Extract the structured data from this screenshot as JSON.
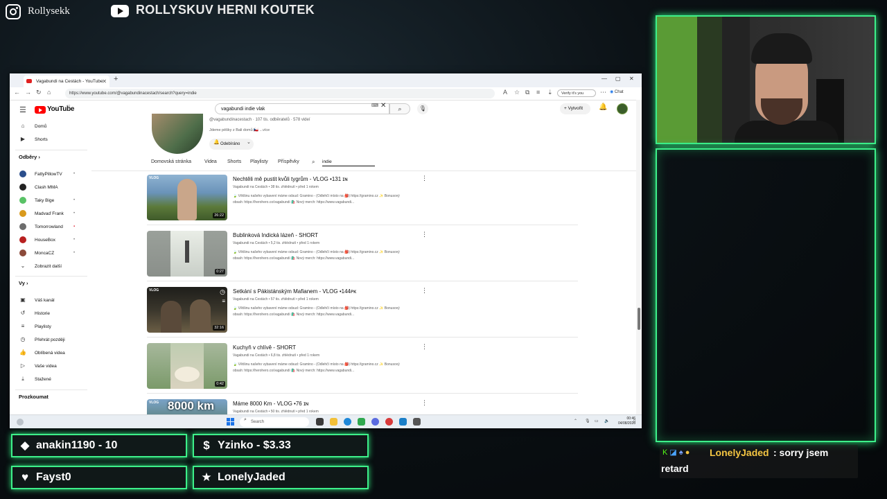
{
  "overlay": {
    "instagram_name": "Rollysekk",
    "youtube_channel": "ROLLYSKUV HERNI KOUTEK",
    "badges": [
      {
        "icon": "diamond-icon",
        "text": "anakin1190 - 10"
      },
      {
        "icon": "dollar-icon",
        "text": "Yzinko - $3.33"
      },
      {
        "icon": "heart-icon",
        "text": "Fayst0"
      },
      {
        "icon": "star-icon",
        "text": "LonelyJaded"
      }
    ],
    "chat": {
      "username": "LonelyJaded",
      "message_line1": ": sorry jsem",
      "message_line2": "retard"
    }
  },
  "browser": {
    "tab_title": "Vagabundi na Cestách - YouTube",
    "url": "https://www.youtube.com/@vagabundinacestach/search?query=indie",
    "verify_label": "Verify it's you",
    "chat_label": "Chat",
    "taskbar_search": "Search",
    "clock_time": "00:46",
    "clock_date": "04/08/2026"
  },
  "youtube": {
    "logo_text": "YouTube",
    "logo_cc": "CZ",
    "search_value": "vagabundi indie vlak",
    "create_label": "Vytvořit",
    "sidebar": {
      "main": [
        {
          "icon": "home-icon",
          "label": "Domů"
        },
        {
          "icon": "shorts-icon",
          "label": "Shorts"
        }
      ],
      "subscriptions_header": "Odběry",
      "subscriptions": [
        {
          "label": "FattyPillowTV",
          "color": "#2b4e8c",
          "live": "•"
        },
        {
          "label": "Clash MMA",
          "color": "#222222",
          "live": ""
        },
        {
          "label": "Taky Bige",
          "color": "#59c266",
          "live": "•"
        },
        {
          "label": "Madvaď Frank",
          "color": "#d99a1d",
          "live": "•"
        },
        {
          "label": "Tomorrowland",
          "color": "#6d6d6d",
          "live": "▪"
        },
        {
          "label": "HouseBox",
          "color": "#b82020",
          "live": "•"
        },
        {
          "label": "MoncaCZ",
          "color": "#8b4a3a",
          "live": "•"
        }
      ],
      "show_more": "Zobrazit další",
      "you_header": "Vy",
      "you_items": [
        {
          "icon": "channel-icon",
          "label": "Váš kanál"
        },
        {
          "icon": "history-icon",
          "label": "Historie"
        },
        {
          "icon": "playlists-icon",
          "label": "Playlisty"
        },
        {
          "icon": "watch-later-icon",
          "label": "Přehrát později"
        },
        {
          "icon": "like-icon",
          "label": "Oblíbená videa"
        },
        {
          "icon": "your-videos-icon",
          "label": "Vaše videa"
        },
        {
          "icon": "download-icon",
          "label": "Stažené"
        }
      ],
      "explore_header": "Prozkoumat"
    },
    "channel": {
      "handle_line": "@vagabundinacestach · 107 tis. odběratelů · 578 videí",
      "description": "Jdeme pěšky z Bali domů 🇨🇿 ...více",
      "subscribed_label": "Odebíráno",
      "tabs": [
        "Domovská stránka",
        "Videa",
        "Shorts",
        "Playlisty",
        "Příspěvky"
      ],
      "search_value": "indie"
    },
    "videos": [
      {
        "title": "Nechtěli mě pustit kvůli tygrům - VLOG •131 ɪɴ",
        "meta": "Vagabundi na Cestách • 38 tis. zhlédnutí • před 1 rokem",
        "desc1": "🍃 Většinu našeho vybavení máme odsud: Gramino - (Odlehčí místo na 🎒) https://gramino.cz ✨ Bonusový",
        "desc2": "obsah: https://herohero.co/vagabundi 🛍️ Nový merch: https://www.vagabundi...",
        "duration": "26:22",
        "badge": "VLOG",
        "thumb_colors": [
          "#6a93b8",
          "#5c7a3a"
        ]
      },
      {
        "title": "Bublinková Indická lázeň - SHORT",
        "meta": "Vagabundi na Cestách • 5,2 tis. zhlédnutí • před 1 rokem",
        "desc1": "🍃 Většinu našeho vybavení máme odsud: Gramino - (Odlehčí místo na 🎒) https://gramino.cz ✨ Bonusový",
        "desc2": "obsah: https://herohero.co/vagabundi 🛍️ Nový merch: https://www.vagabundi...",
        "duration": "0:27",
        "badge": "",
        "thumb_colors": [
          "#8a8f8a",
          "#c9cfc8"
        ]
      },
      {
        "title": "Setkání s Pákistánským Mafianem - VLOG •144ᴘᴋ",
        "meta": "Vagabundi na Cestách • 57 tis. zhlédnutí • před 1 rokem",
        "desc1": "🍃 Většinu našeho vybavení máme odsud: Gramino - (Odlehčí místo na 🎒) https://gramino.cz ✨ Bonusový",
        "desc2": "obsah: https://herohero.co/vagabundi 🛍️ Nový merch: https://www.vagabundi...",
        "duration": "32:16",
        "badge": "VLOG",
        "thumb_colors": [
          "#2b2b24",
          "#6b5e45"
        ]
      },
      {
        "title": "Kuchyň v chlívě - SHORT",
        "meta": "Vagabundi na Cestách • 6,8 tis. zhlédnutí • před 1 rokem",
        "desc1": "🍃 Většinu našeho vybavení máme odsud: Gramino - (Odlehčí místo na 🎒) https://gramino.cz ✨ Bonusový",
        "desc2": "obsah: https://herohero.co/vagabundi 🛍️ Nový merch: https://www.vagabundi...",
        "duration": "0:42",
        "badge": "",
        "thumb_colors": [
          "#7b9a6a",
          "#d9d2bf"
        ]
      },
      {
        "title": "Máme 8000 Km - VLOG •76 ɪɴ",
        "meta": "Vagabundi na Cestách • 50 tis. zhlédnutí • před 1 rokem",
        "desc1": "",
        "desc2": "",
        "duration": "",
        "badge": "VLOG",
        "overlay_text": "8000 km",
        "thumb_colors": [
          "#6a93b8",
          "#3a5d2a"
        ]
      }
    ]
  }
}
